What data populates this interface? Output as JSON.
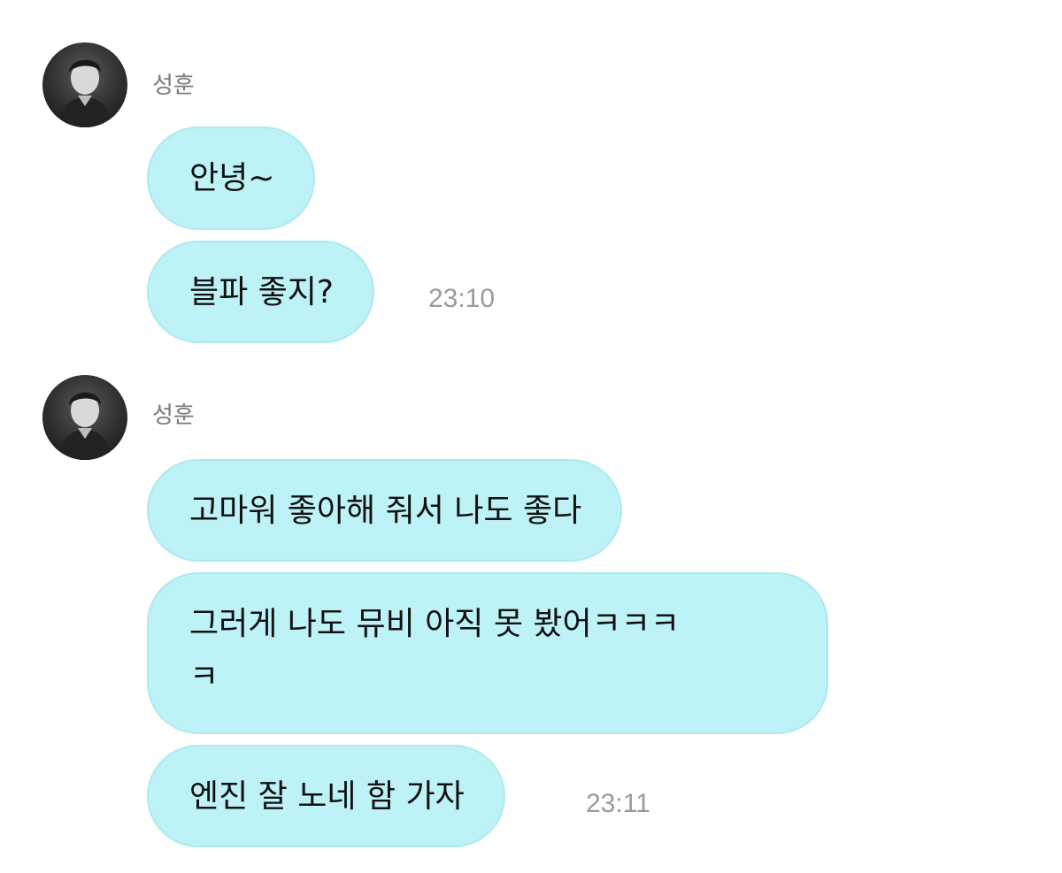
{
  "chat": {
    "groups": [
      {
        "sender": "성훈",
        "messages": [
          "안녕~",
          "블파 좋지?"
        ],
        "time": "23:10"
      },
      {
        "sender": "성훈",
        "messages": [
          "고마워 좋아해 줘서 나도 좋다",
          "그러게 나도 뮤비 아직 못 봤어ㅋㅋㅋ\nㅋ",
          "엔진 잘 노네 함 가자"
        ],
        "time": "23:11"
      }
    ]
  },
  "colors": {
    "bubble_bg": "#bdf2f6",
    "bubble_border": "#aee9ee",
    "text": "#111111",
    "sender_name": "#7a7a7a",
    "timestamp": "#9a9a9a"
  },
  "icons": {
    "avatar": "profile-photo-icon"
  }
}
